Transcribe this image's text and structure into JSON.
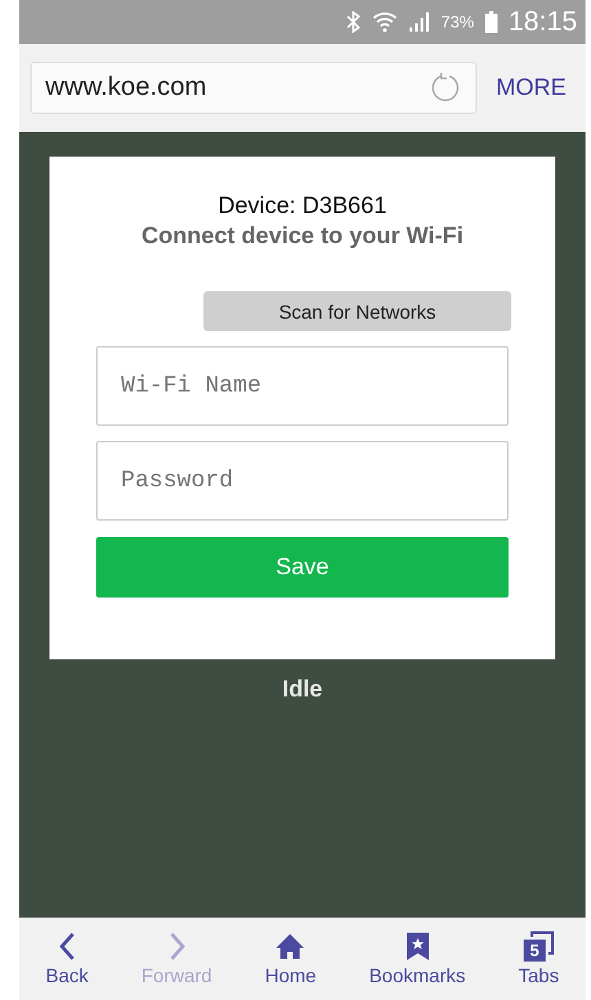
{
  "status_bar": {
    "battery": "73%",
    "time": "18:15"
  },
  "browser": {
    "url": "www.koe.com",
    "more": "MORE"
  },
  "card": {
    "device": "Device: D3B661",
    "subtitle": "Connect device to your Wi-Fi",
    "scan_button": "Scan for Networks",
    "wifi_field": {
      "placeholder": "Wi-Fi Name"
    },
    "password_field": {
      "placeholder": "Password"
    },
    "save_button": "Save"
  },
  "status": "Idle",
  "nav": [
    {
      "kind": "back",
      "label": "Back",
      "disabled": false
    },
    {
      "kind": "forward",
      "label": "Forward",
      "disabled": true
    },
    {
      "kind": "home",
      "label": "Home",
      "disabled": false
    },
    {
      "kind": "bookmarks",
      "label": "Bookmarks",
      "disabled": false
    },
    {
      "kind": "tabs",
      "label": "Tabs",
      "disabled": false,
      "count": "5"
    }
  ]
}
